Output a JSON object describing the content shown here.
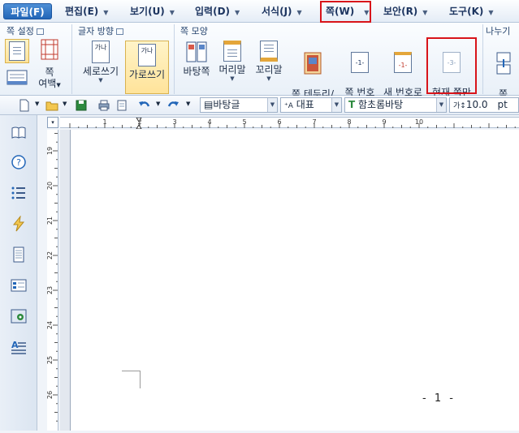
{
  "menubar": {
    "items": [
      {
        "label": "파일(F)"
      },
      {
        "label": "편집(E)"
      },
      {
        "label": "보기(U)"
      },
      {
        "label": "입력(D)"
      },
      {
        "label": "서식(J)"
      },
      {
        "label": "쪽(W)"
      },
      {
        "label": "보안(R)"
      },
      {
        "label": "도구(K)"
      }
    ]
  },
  "ribbon": {
    "groups": {
      "page_setup": "쪽 설정",
      "text_direction": "글자 방향",
      "page_style": "쪽 모양",
      "divide": "나누기"
    },
    "buttons": {
      "margin": "쪽\n여백",
      "vertical": "세로쓰기",
      "horizontal": "가로쓰기",
      "background": "바탕쪽",
      "header": "머리말",
      "footer": "꼬리말",
      "border": "쪽 테두리/\n배경",
      "number": "쪽 번호\n매기기",
      "new_number": "새 번호로\n시작",
      "hide": "현재 쪽만\n감추기",
      "break": "쪽\n나누기"
    },
    "icon_text": {
      "vertical": "가나",
      "horizontal": "가나",
      "number": "-1-",
      "new_number": "-1-",
      "hide": "-3-"
    }
  },
  "toolbar": {
    "style_combo": "바탕글",
    "lang_combo": "대표",
    "font_combo": "함초롬바탕",
    "size_value": "10.0",
    "size_unit": "pt"
  },
  "ruler": {
    "corner": "▾",
    "h_labels": [
      "1",
      "2",
      "3",
      "4",
      "5",
      "6",
      "7",
      "8",
      "9",
      "10"
    ],
    "v_labels": [
      "19",
      "20",
      "21",
      "22",
      "23",
      "24",
      "25",
      "26"
    ]
  },
  "document": {
    "page_number": "- 1 -"
  },
  "colors": {
    "highlight_box": "#d8141a",
    "file_menu_bg": "#2266b8"
  }
}
